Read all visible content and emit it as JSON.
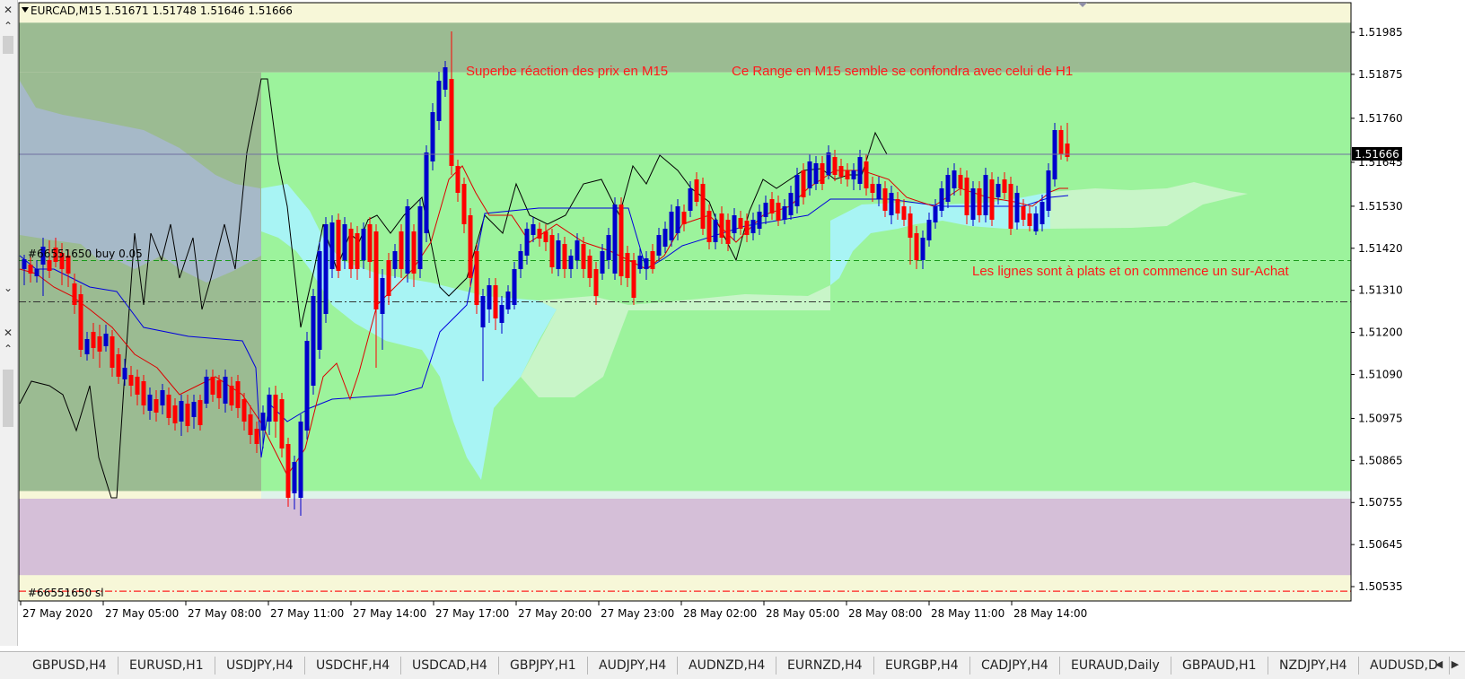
{
  "header": {
    "symbol_label": "EURCAD,M15",
    "quote_values": "1.51671 1.51748 1.51646 1.51666"
  },
  "current_price_tag": "1.51666",
  "orders": {
    "buy_label": "#66551650 buy 0.05",
    "sl_label": "#66551650 sl"
  },
  "annotations": [
    "Superbe réaction des prix en M15",
    "Ce Range en M15 semble se confondra avec celui de H1",
    "Les lignes sont à plats et on commence un sur-Achat"
  ],
  "tabs": [
    "GBPUSD,H4",
    "EURUSD,H1",
    "USDJPY,H4",
    "USDCHF,H4",
    "USDCAD,H4",
    "GBPJPY,H1",
    "AUDJPY,H4",
    "AUDNZD,H4",
    "EURNZD,H4",
    "EURGBP,H4",
    "CADJPY,H4",
    "EURAUD,Daily",
    "GBPAUD,H1",
    "NZDJPY,H4",
    "AUDUSD,D"
  ],
  "colors": {
    "bull_candle": "#0000cc",
    "bear_candle": "#ff0000",
    "price_zone_green": "#9cf39c",
    "zone_dark_green": "#9bbb92",
    "zone_purple": "#d5bfd8",
    "cloud_cyan": "#a8f4f4",
    "tenkan_red": "#dd0000",
    "kijun_blue": "#0000dd",
    "chikou_black": "#000000",
    "annotation_red": "#ff1a1a"
  },
  "chart_data": {
    "type": "candlestick",
    "symbol": "EURCAD",
    "timeframe": "M15",
    "y_axis_ticks": [
      1.51985,
      1.51875,
      1.5176,
      1.51645,
      1.5153,
      1.5142,
      1.5131,
      1.512,
      1.5109,
      1.50975,
      1.50865,
      1.50755,
      1.50645,
      1.50535
    ],
    "ylim": [
      1.505,
      1.5201
    ],
    "x_axis_ticks": [
      "27 May 2020",
      "27 May 05:00",
      "27 May 08:00",
      "27 May 11:00",
      "27 May 14:00",
      "27 May 17:00",
      "27 May 20:00",
      "27 May 23:00",
      "28 May 02:00",
      "28 May 05:00",
      "28 May 08:00",
      "28 May 11:00",
      "28 May 14:00"
    ],
    "current_price": 1.51666,
    "levels": {
      "buy_entry": 1.51388,
      "sl": 1.50523,
      "entry_dashdot": 1.5128
    },
    "zones": {
      "dark_top": [
        1.5188,
        1.5201
      ],
      "green_range": [
        1.50785,
        1.5188
      ],
      "light_band": [
        1.50765,
        1.50785
      ],
      "purple": [
        1.50565,
        1.50765
      ]
    }
  }
}
